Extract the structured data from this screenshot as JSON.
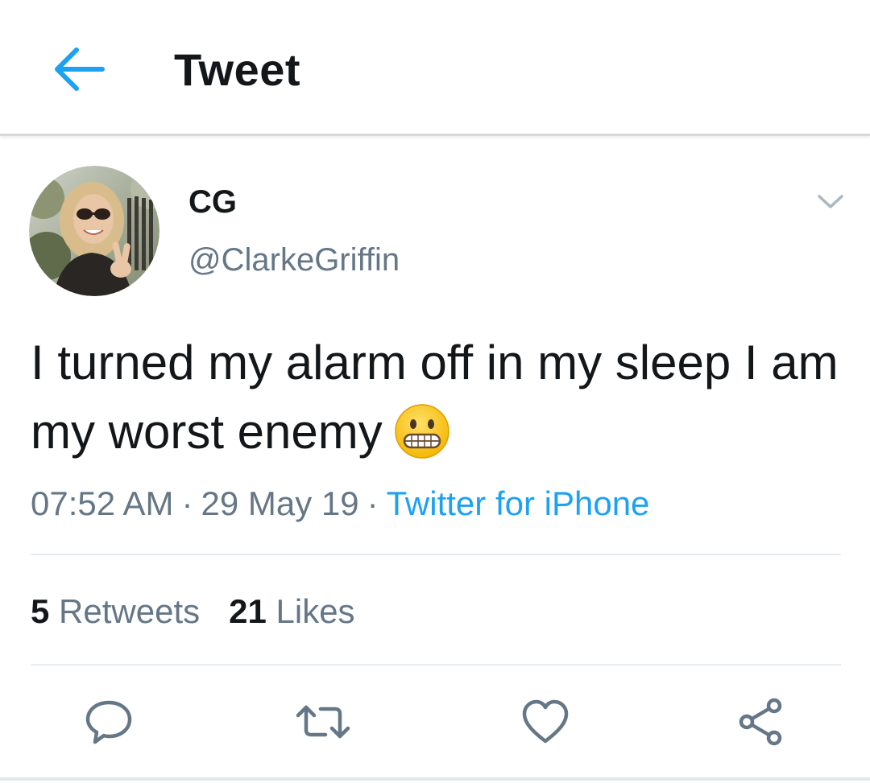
{
  "header": {
    "title": "Tweet",
    "back_icon": "arrow-left-icon"
  },
  "author": {
    "display_name": "CG",
    "handle": "@ClarkeGriffin",
    "avatar_icon": "profile-photo"
  },
  "tweet": {
    "text": "I turned my alarm off in my sleep I am my worst enemy",
    "emoji": "grimacing-face",
    "time": "07:52 AM",
    "date": "29 May 19",
    "separator": "·",
    "source": "Twitter for iPhone"
  },
  "stats": {
    "retweets_count": "5",
    "retweets_label": "Retweets",
    "likes_count": "21",
    "likes_label": "Likes"
  },
  "actions": [
    {
      "icon": "reply-icon"
    },
    {
      "icon": "retweet-icon"
    },
    {
      "icon": "like-icon"
    },
    {
      "icon": "share-icon"
    }
  ],
  "colors": {
    "accent": "#1da1f2",
    "text_primary": "#14171a",
    "text_secondary": "#657786",
    "divider": "#e6ecf0"
  }
}
